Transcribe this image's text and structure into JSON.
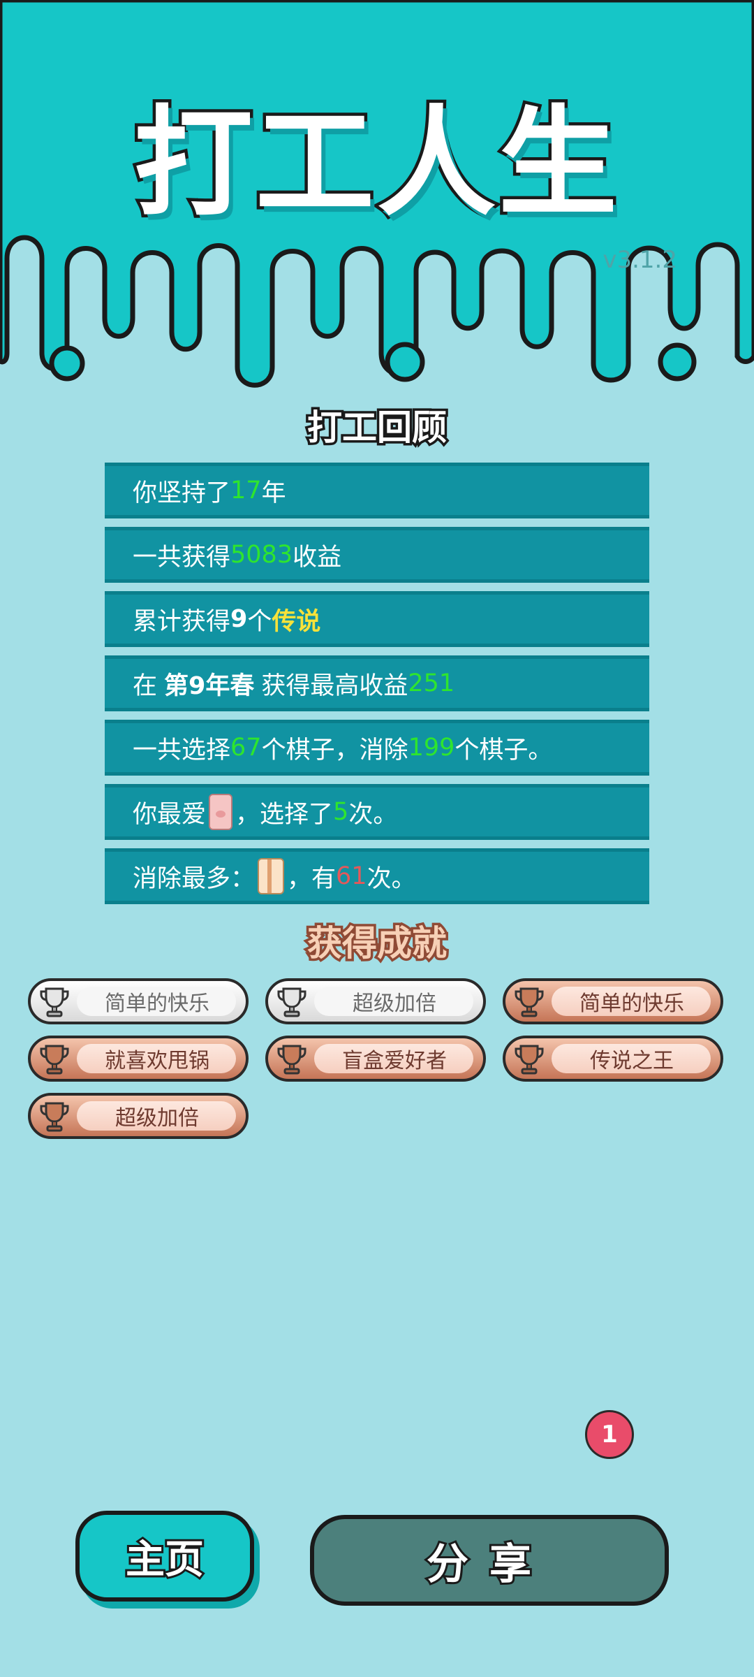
{
  "app": {
    "title": "打工人生",
    "version": "v3.1.2"
  },
  "review": {
    "title": "打工回顾",
    "years": {
      "pre": "你坚持了",
      "value": "17",
      "post": "年"
    },
    "income": {
      "pre": "一共获得",
      "value": "5083",
      "post": "收益"
    },
    "legend": {
      "pre": "累计获得",
      "count": "9",
      "mid": "个",
      "word": "传说"
    },
    "best": {
      "pre": "在",
      "season": "第9年春",
      "mid": "获得最高收益",
      "value": "251"
    },
    "pieces": {
      "pre": "一共选择",
      "chosen": "67",
      "mid": "个棋子，消除",
      "removed": "199",
      "post": "个棋子。"
    },
    "favorite": {
      "pre": "你最爱",
      "icon": "pig-icon",
      "mid": "，选择了",
      "value": "5",
      "post": "次。"
    },
    "most_removed": {
      "pre": "消除最多：",
      "icon": "box-icon",
      "mid": "，有",
      "value": "61",
      "post": "次。"
    }
  },
  "achievements": {
    "title": "获得成就",
    "items": [
      {
        "label": "简单的快乐",
        "tier": "silver"
      },
      {
        "label": "超级加倍",
        "tier": "silver"
      },
      {
        "label": "简单的快乐",
        "tier": "bronze"
      },
      {
        "label": "就喜欢甩锅",
        "tier": "bronze"
      },
      {
        "label": "盲盒爱好者",
        "tier": "bronze"
      },
      {
        "label": "传说之王",
        "tier": "bronze"
      },
      {
        "label": "超级加倍",
        "tier": "bronze"
      }
    ]
  },
  "notification": {
    "count": "1"
  },
  "buttons": {
    "home": "主页",
    "share": "分享"
  },
  "colors": {
    "background": "#a3dfe6",
    "header": "#16c6c7",
    "stat_row": "#1193a2",
    "highlight_green": "#2ee52e",
    "highlight_yellow": "#f7e23a",
    "highlight_red": "#e3595b",
    "share_button": "#4c807c"
  }
}
